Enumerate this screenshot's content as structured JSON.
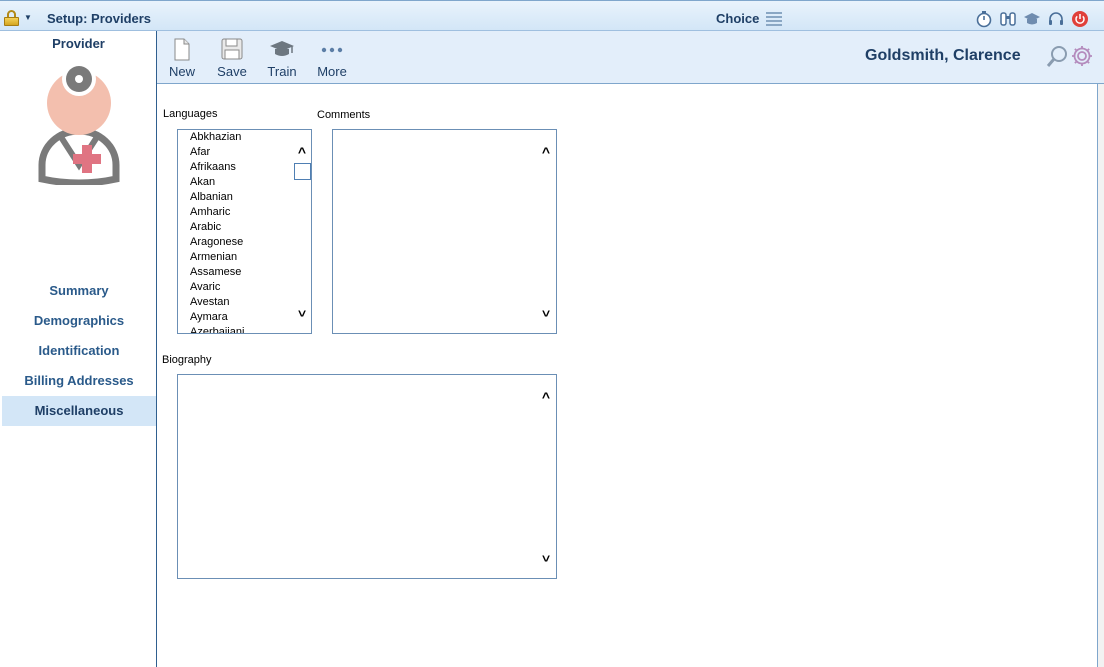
{
  "titlebar": {
    "title": "Setup: Providers",
    "choice": "Choice"
  },
  "sidebar": {
    "title": "Provider",
    "nav": [
      {
        "label": "Summary"
      },
      {
        "label": "Demographics"
      },
      {
        "label": "Identification"
      },
      {
        "label": "Billing Addresses"
      },
      {
        "label": "Miscellaneous"
      }
    ]
  },
  "toolbar": {
    "new_label": "New",
    "save_label": "Save",
    "train_label": "Train",
    "more_label": "More",
    "patient_name": "Goldsmith, Clarence"
  },
  "form": {
    "languages_label": "Languages",
    "comments_label": "Comments",
    "biography_label": "Biography",
    "languages": [
      "Abkhazian",
      "Afar",
      "Afrikaans",
      "Akan",
      "Albanian",
      "Amharic",
      "Arabic",
      "Aragonese",
      "Armenian",
      "Assamese",
      "Avaric",
      "Avestan",
      "Aymara",
      "Azerbaijani"
    ],
    "comments_value": "",
    "biography_value": ""
  },
  "icons": {
    "titlebar": [
      "timer-icon",
      "binoculars-icon",
      "graduation-cap-icon",
      "headset-icon",
      "power-icon"
    ]
  },
  "colors": {
    "accent": "#1f3f66",
    "toolbar_bg": "#e3eefa",
    "active_nav": "#d3e6f7",
    "power": "#e0403a"
  }
}
